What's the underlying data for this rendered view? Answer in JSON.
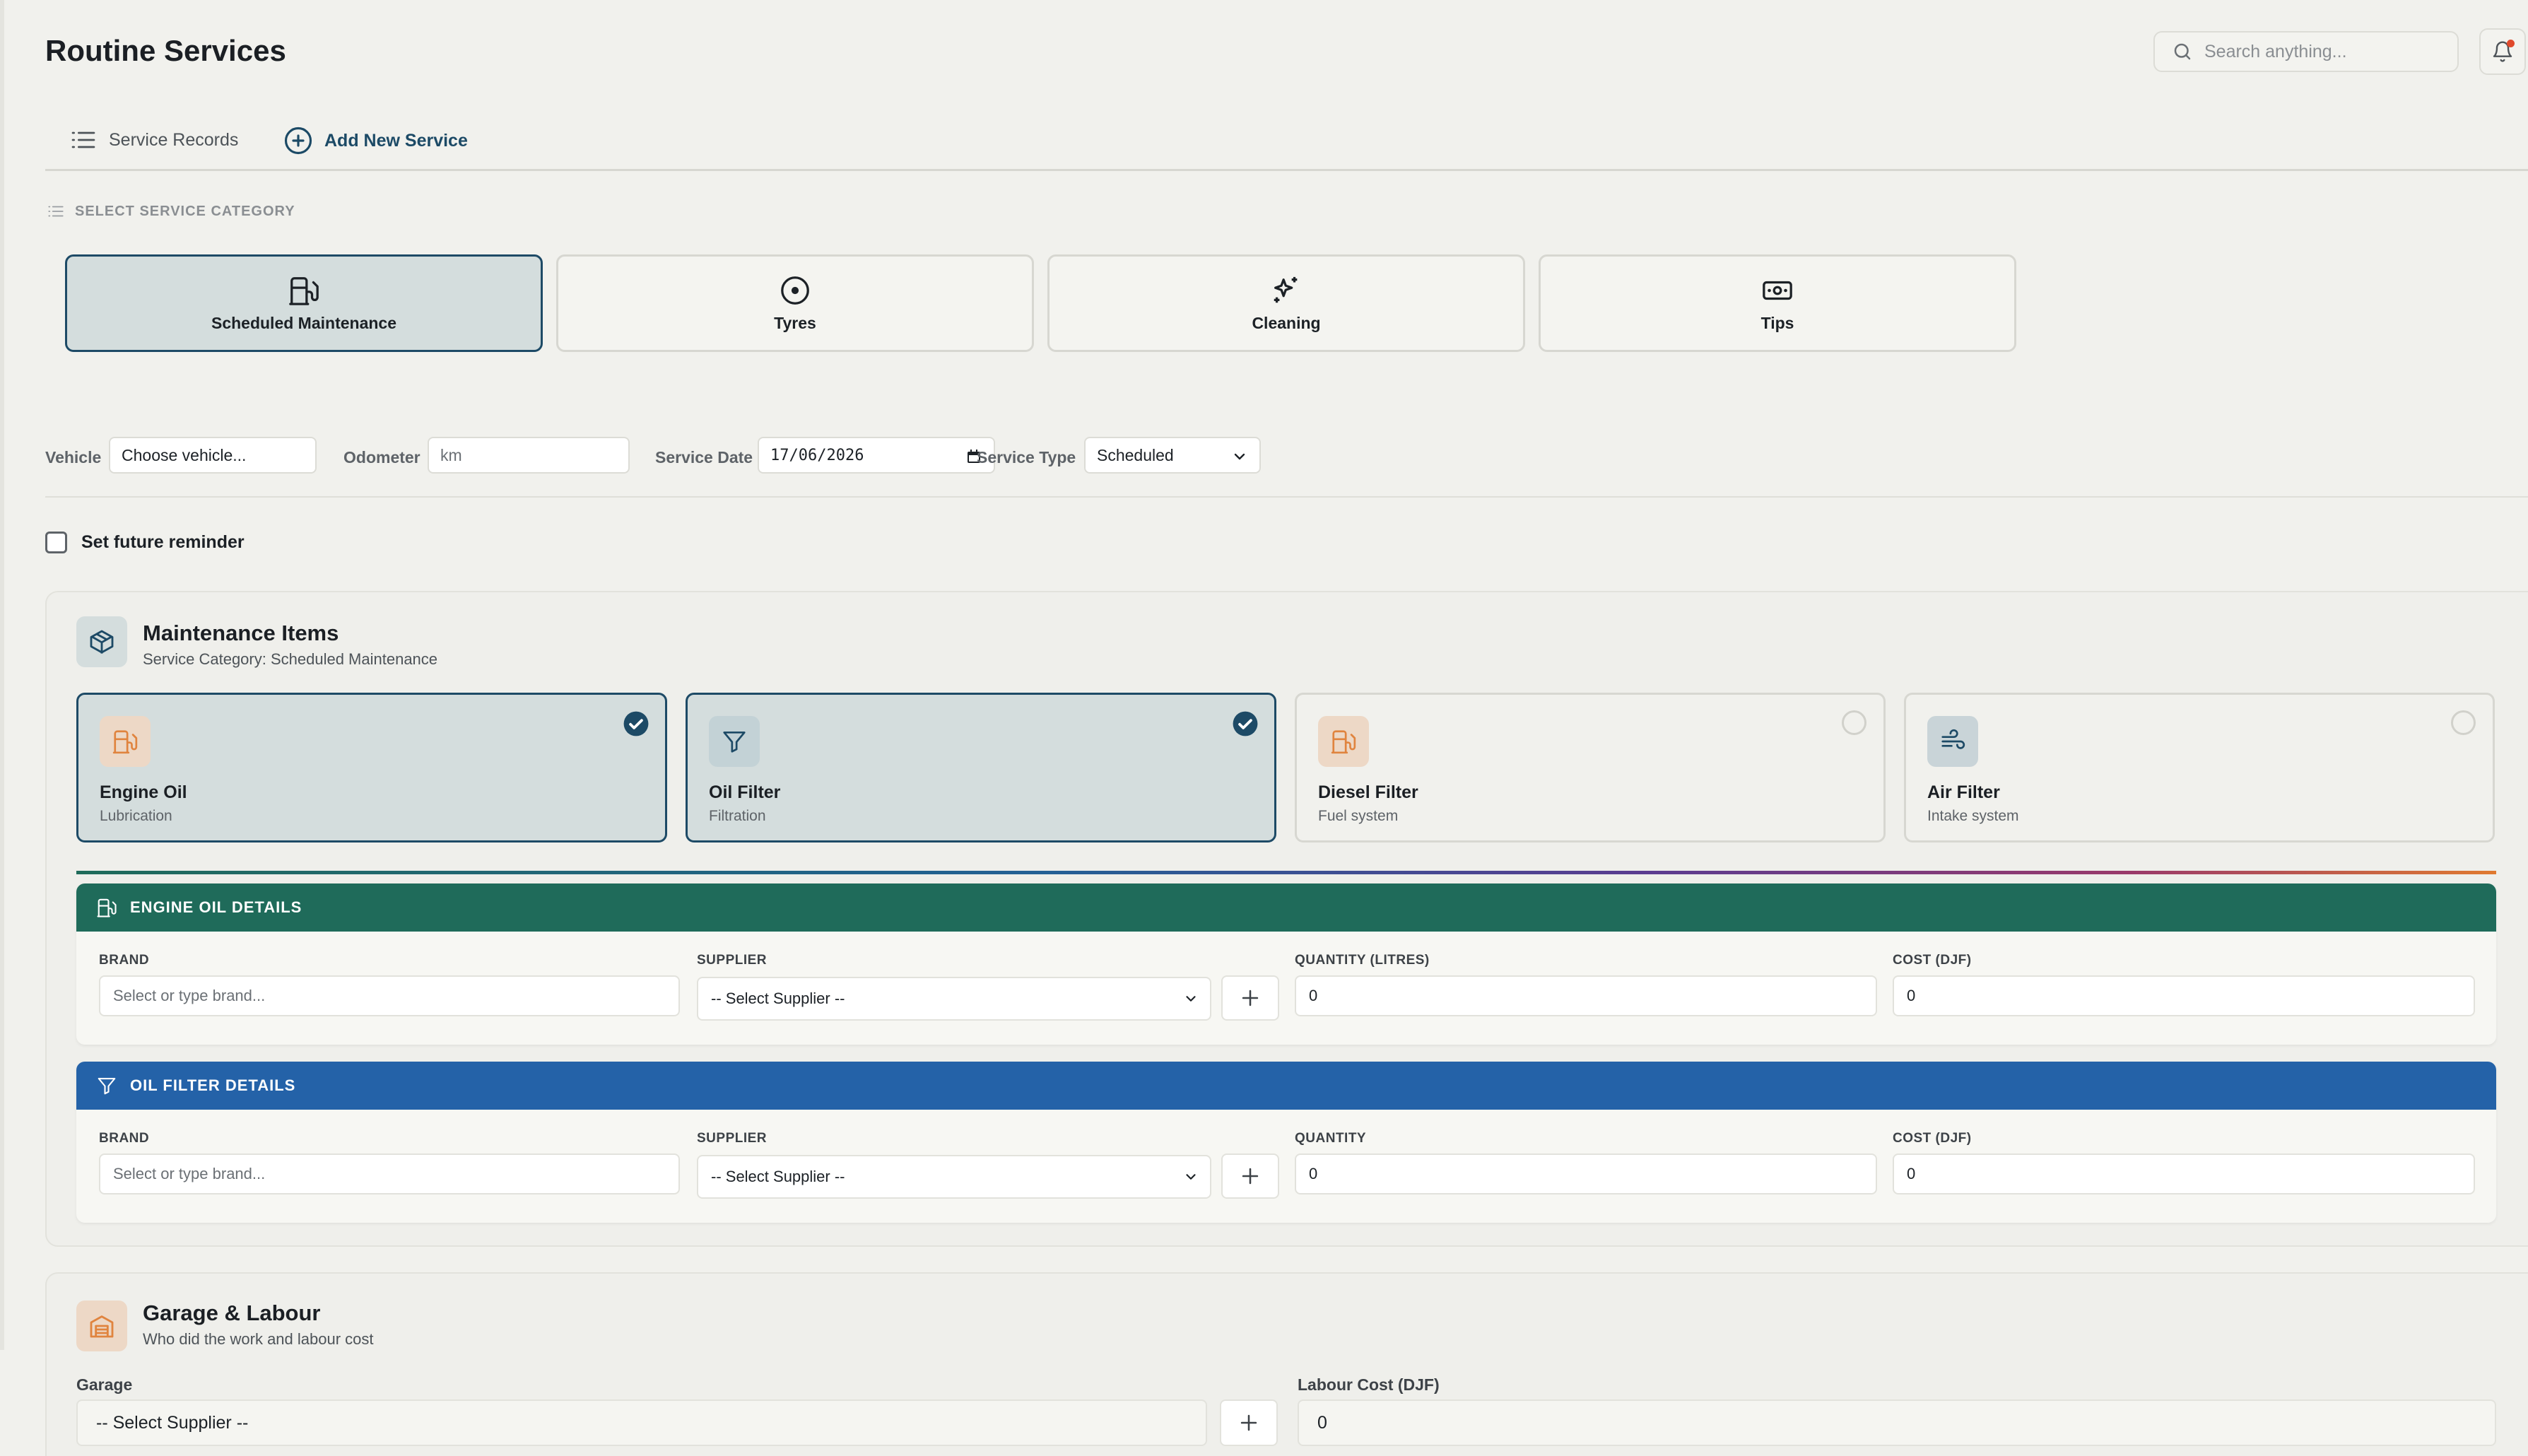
{
  "header": {
    "title": "Routine Services",
    "search_placeholder": "Search anything..."
  },
  "tabs": [
    {
      "label": "Service Records",
      "icon": "list-icon"
    },
    {
      "label": "Add New Service",
      "icon": "plus-circle-icon"
    }
  ],
  "category": {
    "heading": "SELECT SERVICE CATEGORY",
    "options": [
      {
        "label": "Scheduled Maintenance",
        "icon": "fuel-pump-icon",
        "selected": true
      },
      {
        "label": "Tyres",
        "icon": "tyre-icon",
        "selected": false
      },
      {
        "label": "Cleaning",
        "icon": "sparkles-icon",
        "selected": false
      },
      {
        "label": "Tips",
        "icon": "banknote-icon",
        "selected": false
      }
    ]
  },
  "form": {
    "vehicle_label": "Vehicle",
    "vehicle_value": "Choose vehicle...",
    "odometer_label": "Odometer",
    "odometer_placeholder": "km",
    "service_date_label": "Service Date",
    "service_date_value": "17/06/2026",
    "service_type_label": "Service Type",
    "service_type_value": "Scheduled"
  },
  "reminder": {
    "label": "Set future reminder",
    "checked": false
  },
  "maintenance": {
    "title": "Maintenance Items",
    "subtitle": "Service Category: Scheduled Maintenance",
    "items": [
      {
        "name": "Engine Oil",
        "sub": "Lubrication",
        "selected": true,
        "icon": "fuel-pump-icon"
      },
      {
        "name": "Oil Filter",
        "sub": "Filtration",
        "selected": true,
        "icon": "filter-icon"
      },
      {
        "name": "Diesel Filter",
        "sub": "Fuel system",
        "selected": false,
        "icon": "fuel-pump-icon"
      },
      {
        "name": "Air Filter",
        "sub": "Intake system",
        "selected": false,
        "icon": "wind-icon"
      }
    ],
    "engine_oil_details": {
      "title": "ENGINE OIL DETAILS",
      "color": "#1f6b5a",
      "brand_label": "BRAND",
      "brand_placeholder": "Select or type brand...",
      "supplier_label": "SUPPLIER",
      "supplier_value": "-- Select Supplier --",
      "quantity_label": "QUANTITY (LITRES)",
      "quantity_value": "0",
      "cost_label": "COST (DJF)",
      "cost_value": "0"
    },
    "oil_filter_details": {
      "title": "OIL FILTER DETAILS",
      "color": "#2462a8",
      "brand_label": "BRAND",
      "brand_placeholder": "Select or type brand...",
      "supplier_label": "SUPPLIER",
      "supplier_value": "-- Select Supplier --",
      "quantity_label": "QUANTITY",
      "quantity_value": "0",
      "cost_label": "COST (DJF)",
      "cost_value": "0"
    }
  },
  "garage": {
    "title": "Garage & Labour",
    "subtitle": "Who did the work and labour cost",
    "garage_label": "Garage",
    "garage_value": "-- Select Supplier --",
    "labour_label": "Labour Cost (DJF)",
    "labour_value": "0"
  },
  "colors": {
    "accent": "#1d4a66",
    "selected_bg": "#d4dddd",
    "orange_icon": "#e0843f"
  }
}
